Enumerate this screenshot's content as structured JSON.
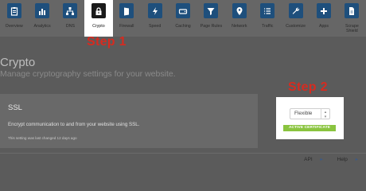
{
  "nav": {
    "items": [
      {
        "label": "Overview",
        "icon": "clipboard-icon",
        "active": false
      },
      {
        "label": "Analytics",
        "icon": "bar-chart-icon",
        "active": false
      },
      {
        "label": "DNS",
        "icon": "network-tree-icon",
        "active": false
      },
      {
        "label": "Crypto",
        "icon": "lock-icon",
        "active": true
      },
      {
        "label": "Firewall",
        "icon": "firewall-icon",
        "active": false
      },
      {
        "label": "Speed",
        "icon": "lightning-icon",
        "active": false
      },
      {
        "label": "Caching",
        "icon": "hard-drive-icon",
        "active": false
      },
      {
        "label": "Page Rules",
        "icon": "filter-icon",
        "active": false
      },
      {
        "label": "Network",
        "icon": "location-pin-icon",
        "active": false
      },
      {
        "label": "Traffic",
        "icon": "list-icon",
        "active": false
      },
      {
        "label": "Customize",
        "icon": "wrench-icon",
        "active": false
      },
      {
        "label": "Apps",
        "icon": "plus-icon",
        "active": false
      },
      {
        "label": "Scrape\nShield",
        "icon": "document-icon",
        "active": false
      }
    ]
  },
  "annotations": {
    "step1": "Step 1",
    "step2": "Step 2"
  },
  "page": {
    "title": "Crypto",
    "subtitle": "Manage cryptography settings for your website."
  },
  "ssl": {
    "title": "SSL",
    "description": "Encrypt communication to and from your website using SSL.",
    "note": "This setting was last changed 12 days ago",
    "mode": "Flexible",
    "status": "ACTIVE CERTIFICATE"
  },
  "footer": {
    "api": "API",
    "help": "Help"
  },
  "colors": {
    "icon_box": "#1e4f7c",
    "active_icon_box": "#1a1a1a",
    "step_label": "#d62b20",
    "badge": "#8ac43f"
  }
}
